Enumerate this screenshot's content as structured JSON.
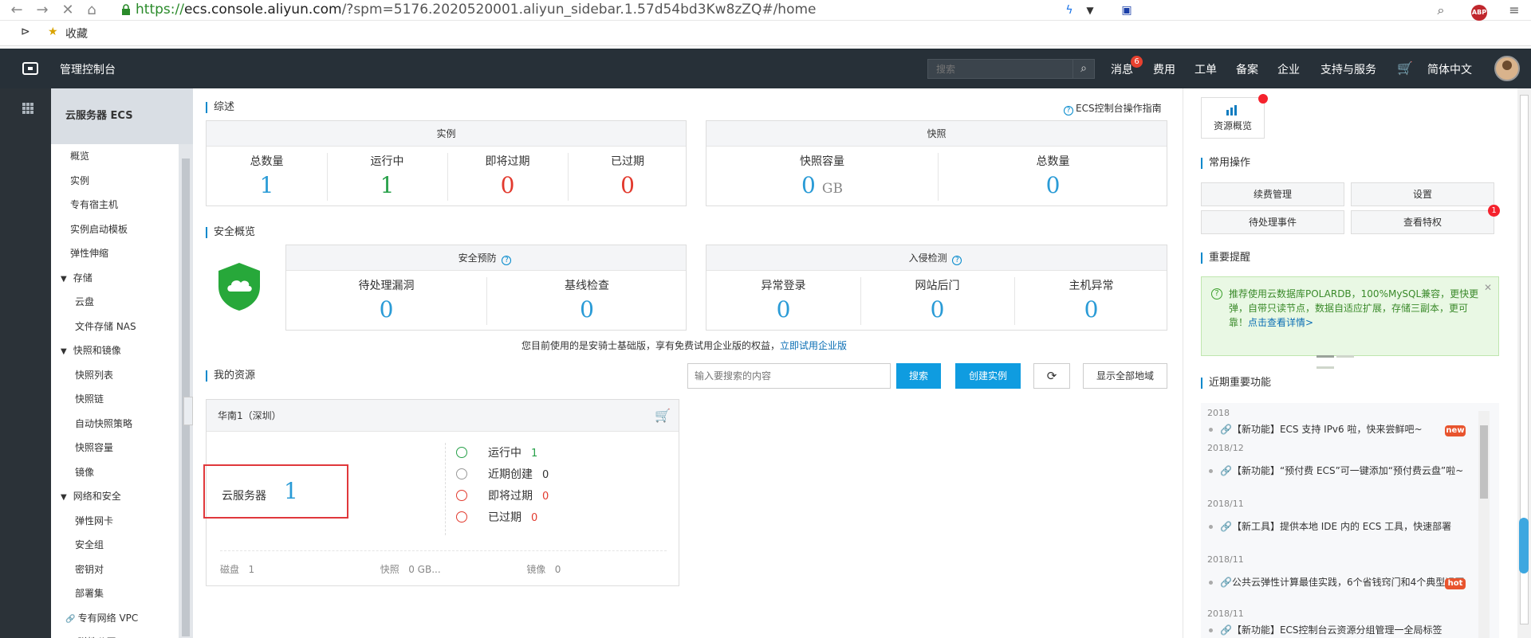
{
  "browser": {
    "url_scheme": "https://",
    "url_host": "ecs.console.aliyun.com",
    "url_rest": "/?spm=5176.2020520001.aliyun_sidebar.1.57d54bd3Kw8zZQ#/home",
    "bookmark_label": "收藏"
  },
  "topbar": {
    "title": "管理控制台",
    "search_placeholder": "搜索",
    "messages": "消息",
    "messages_badge": "6",
    "billing": "费用",
    "tickets": "工单",
    "filing": "备案",
    "enterprise": "企业",
    "support": "支持与服务",
    "language": "简体中文"
  },
  "sidebar": {
    "header": "云服务器 ECS",
    "items": [
      {
        "label": "概览",
        "level": 0,
        "active": true
      },
      {
        "label": "实例",
        "level": 0
      },
      {
        "label": "专有宿主机",
        "level": 0
      },
      {
        "label": "实例启动模板",
        "level": 0
      },
      {
        "label": "弹性伸缩",
        "level": 0
      },
      {
        "label": "存储",
        "level": 0,
        "group": true
      },
      {
        "label": "云盘",
        "level": 1
      },
      {
        "label": "文件存储 NAS",
        "level": 1
      },
      {
        "label": "快照和镜像",
        "level": 0,
        "group": true
      },
      {
        "label": "快照列表",
        "level": 1
      },
      {
        "label": "快照链",
        "level": 1
      },
      {
        "label": "自动快照策略",
        "level": 1
      },
      {
        "label": "快照容量",
        "level": 1
      },
      {
        "label": "镜像",
        "level": 1
      },
      {
        "label": "网络和安全",
        "level": 0,
        "group": true
      },
      {
        "label": "弹性网卡",
        "level": 1
      },
      {
        "label": "安全组",
        "level": 1
      },
      {
        "label": "密钥对",
        "level": 1
      },
      {
        "label": "部署集",
        "level": 1
      },
      {
        "label": "专有网络 VPC",
        "level": 1,
        "link": true
      },
      {
        "label": "弹性公网 IP",
        "level": 1,
        "link": true
      }
    ]
  },
  "overview": {
    "title": "综述",
    "guide_link": "ECS控制台操作指南",
    "instances": {
      "header": "实例",
      "metrics": [
        {
          "label": "总数量",
          "value": "1"
        },
        {
          "label": "运行中",
          "value": "1"
        },
        {
          "label": "即将过期",
          "value": "0"
        },
        {
          "label": "已过期",
          "value": "0"
        }
      ]
    },
    "snapshots": {
      "header": "快照",
      "metrics": [
        {
          "label": "快照容量",
          "value": "0",
          "unit": "GB"
        },
        {
          "label": "总数量",
          "value": "0"
        }
      ]
    }
  },
  "security": {
    "title": "安全概览",
    "prevention": {
      "header": "安全预防",
      "metrics": [
        {
          "label": "待处理漏洞",
          "value": "0"
        },
        {
          "label": "基线检查",
          "value": "0"
        }
      ]
    },
    "intrusion": {
      "header": "入侵检测",
      "metrics": [
        {
          "label": "异常登录",
          "value": "0"
        },
        {
          "label": "网站后门",
          "value": "0"
        },
        {
          "label": "主机异常",
          "value": "0"
        }
      ]
    },
    "notice": "您目前使用的是安骑士基础版，享有免费试用企业版的权益，",
    "notice_link": "立即试用企业版"
  },
  "resources": {
    "title": "我的资源",
    "search_placeholder": "输入要搜索的内容",
    "search_button": "搜索",
    "create_button": "创建实例",
    "show_all_button": "显示全部地域",
    "region": {
      "name": "华南1（深圳）",
      "server_label": "云服务器",
      "server_count": "1",
      "stats": [
        {
          "label": "运行中",
          "value": "1"
        },
        {
          "label": "近期创建",
          "value": "0"
        },
        {
          "label": "即将过期",
          "value": "0"
        },
        {
          "label": "已过期",
          "value": "0"
        }
      ],
      "footer": [
        {
          "label": "磁盘",
          "value": "1"
        },
        {
          "label": "快照",
          "value": "0 GB..."
        },
        {
          "label": "镜像",
          "value": "0"
        }
      ]
    }
  },
  "right": {
    "resource_overview": "资源概览",
    "common_ops_title": "常用操作",
    "ops": [
      "续费管理",
      "设置",
      "待处理事件",
      "查看特权"
    ],
    "ops_badge": "1",
    "reminders_title": "重要提醒",
    "alert_text": "推荐使用云数据库POLARDB，100%MySQL兼容，更快更弹，自带只读节点，数据自适应扩展，存储三副本，更可靠！",
    "alert_link": "点击查看详情>",
    "features_title": "近期重要功能",
    "features": [
      {
        "year": "2018",
        "text": "【新功能】ECS 支持 IPv6 啦，快来尝鲜吧~",
        "tag": "new",
        "date": "2018/12"
      },
      {
        "text": "【新功能】“预付费 ECS”可一键添加“预付费云盘”啦~",
        "date": "2018/11"
      },
      {
        "text": "【新工具】提供本地 IDE 内的 ECS 工具，快速部署",
        "date": "2018/11"
      },
      {
        "text": "公共云弹性计算最佳实践，6个省钱窍门和4个典型误区",
        "tag": "hot",
        "date": "2018/11"
      },
      {
        "text": "【新功能】ECS控制台云资源分组管理一全局标签"
      }
    ]
  },
  "colors": {
    "topbar_bg": "#273038",
    "accent_blue": "#0f9ce0",
    "value_blue": "#2a9bd6",
    "value_green": "#26a048",
    "value_red": "#e23a2e",
    "highlight_red": "#e0383b"
  }
}
